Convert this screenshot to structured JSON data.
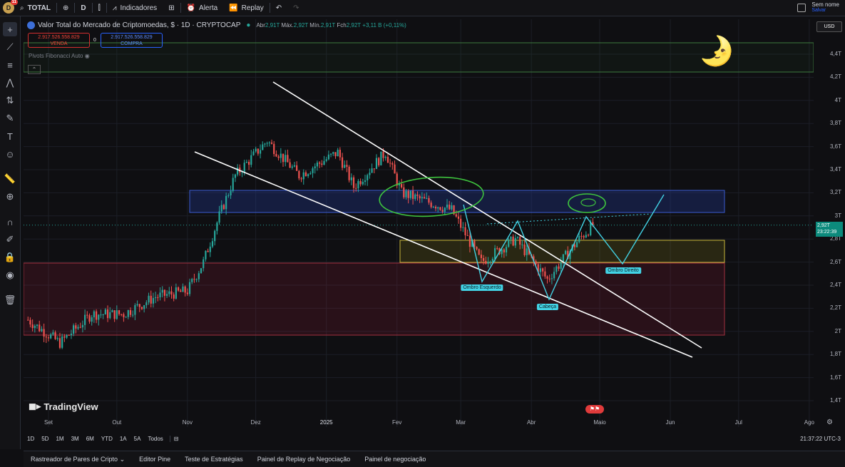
{
  "topbar": {
    "user_initial": "D",
    "badge": "11",
    "symbol": "TOTAL",
    "interval": "D",
    "indicators": "Indicadores",
    "alert": "Alerta",
    "replay": "Replay",
    "layout_name": "Sem nome",
    "save": "Salvar"
  },
  "legend": {
    "title": "Valor Total do Mercado de Criptomoedas, $ · 1D · CRYPTOCAP",
    "open": "2,91T",
    "high": "2,92T",
    "low": "2,91T",
    "close": "2,92T",
    "change": "+3,11 B (+0,11%)"
  },
  "trade": {
    "sell_price": "2.917.526.558.829",
    "sell_label": "VENDA",
    "spread": "0",
    "buy_price": "2.917.526.558.829",
    "buy_label": "COMPRA"
  },
  "pivots_label": "Pivots Fibonacci Auto",
  "currency": "USD",
  "price_tag": {
    "price": "2,92T",
    "countdown": "23:22:39"
  },
  "annotations": {
    "left_shoulder": "Ombro Esquerdo",
    "head": "Cabeça",
    "right_shoulder": "Ombro Direito"
  },
  "brand": "TradingView",
  "ranges": [
    "1D",
    "5D",
    "1M",
    "3M",
    "6M",
    "YTD",
    "1A",
    "5A",
    "Todos"
  ],
  "clock": "21:37:22 UTC-3",
  "footer_tabs": [
    "Rastreador de Pares de Cripto",
    "Editor Pine",
    "Teste de Estratégias",
    "Painel de Replay de Negociação",
    "Painel de negociação"
  ],
  "colors": {
    "up": "#26a69a",
    "down": "#ef5350",
    "trendline": "#ffffff",
    "pattern": "#42d3e5",
    "circle": "#3ec43e"
  },
  "chart_data": {
    "type": "candlestick",
    "x_ticks": [
      "Set",
      "Out",
      "Nov",
      "Dez",
      "2025",
      "Fev",
      "Mar",
      "Abr",
      "Maio",
      "Jun",
      "Jul",
      "Ago"
    ],
    "y_ticks": [
      "4,4T",
      "4,2T",
      "4T",
      "3,8T",
      "3,6T",
      "3,4T",
      "3,2T",
      "3T",
      "2,8T",
      "2,6T",
      "2,4T",
      "2,2T",
      "2T",
      "1,8T",
      "1,6T",
      "1,4T"
    ],
    "ylim": [
      1.35,
      4.55
    ],
    "last_price": 2.92,
    "close_trajectory": [
      {
        "date": "2024-08-23",
        "value": 2.1
      },
      {
        "date": "2024-09-06",
        "value": 1.9
      },
      {
        "date": "2024-09-20",
        "value": 2.15
      },
      {
        "date": "2024-10-04",
        "value": 2.15
      },
      {
        "date": "2024-10-18",
        "value": 2.3
      },
      {
        "date": "2024-11-01",
        "value": 2.35
      },
      {
        "date": "2024-11-08",
        "value": 2.6
      },
      {
        "date": "2024-11-15",
        "value": 3.0
      },
      {
        "date": "2024-11-22",
        "value": 3.35
      },
      {
        "date": "2024-12-06",
        "value": 3.65
      },
      {
        "date": "2024-12-20",
        "value": 3.35
      },
      {
        "date": "2025-01-06",
        "value": 3.55
      },
      {
        "date": "2025-01-13",
        "value": 3.25
      },
      {
        "date": "2025-01-27",
        "value": 3.55
      },
      {
        "date": "2025-02-03",
        "value": 3.2
      },
      {
        "date": "2025-02-25",
        "value": 3.05
      },
      {
        "date": "2025-03-10",
        "value": 2.6
      },
      {
        "date": "2025-03-25",
        "value": 2.8
      },
      {
        "date": "2025-04-08",
        "value": 2.45
      },
      {
        "date": "2025-04-22",
        "value": 2.8
      },
      {
        "date": "2025-04-28",
        "value": 2.92
      }
    ]
  }
}
